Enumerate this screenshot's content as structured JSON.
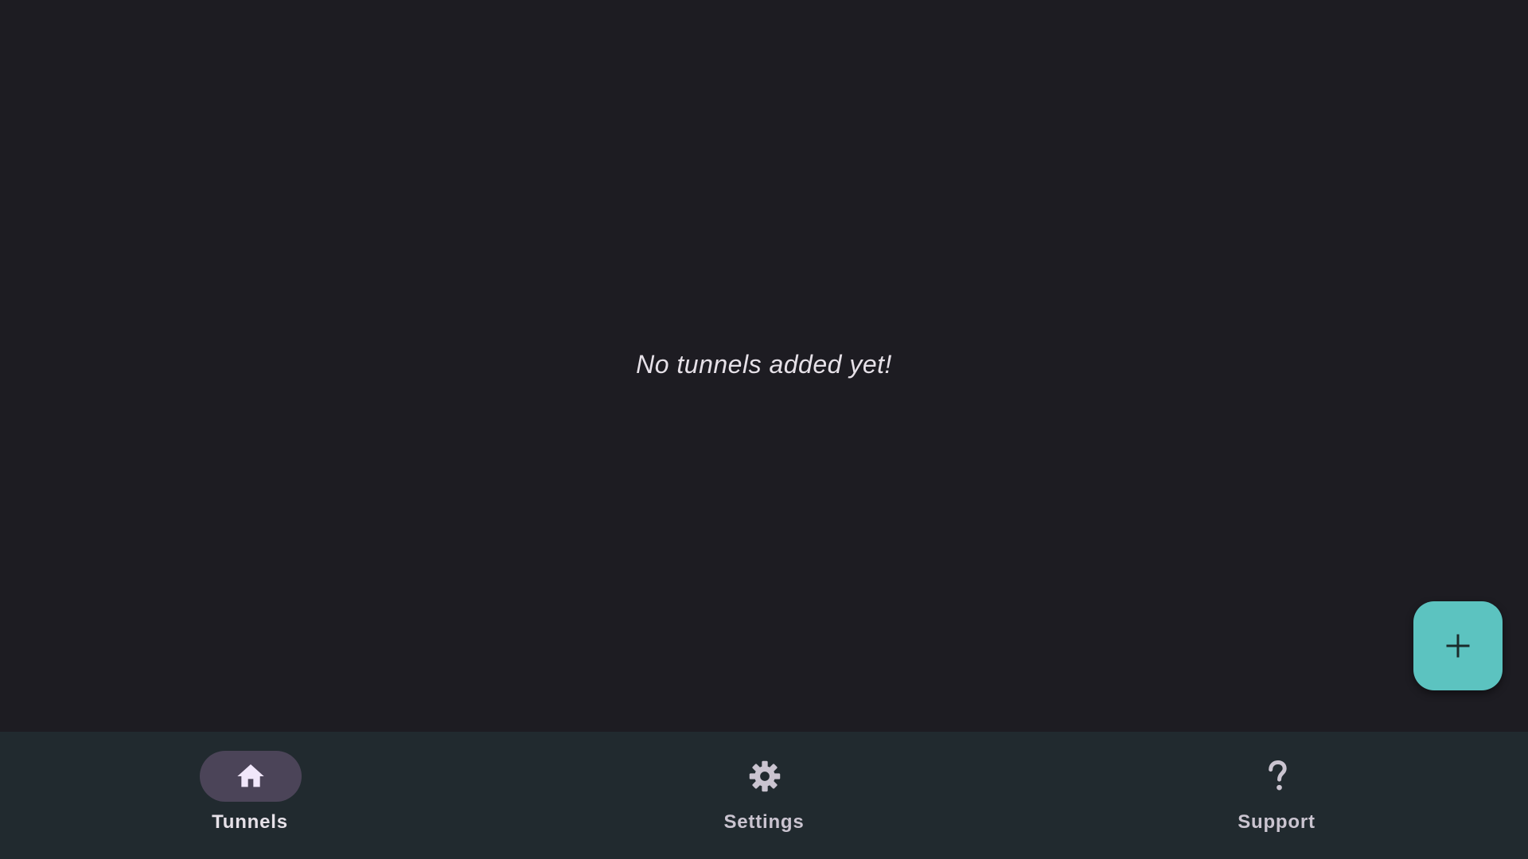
{
  "main": {
    "empty_message": "No tunnels added yet!"
  },
  "fab": {
    "icon": "plus-icon",
    "color": "#5cc3c0"
  },
  "nav": {
    "items": [
      {
        "label": "Tunnels",
        "icon": "home-icon",
        "selected": true
      },
      {
        "label": "Settings",
        "icon": "gear-icon",
        "selected": false
      },
      {
        "label": "Support",
        "icon": "question-mark-icon",
        "selected": false
      }
    ]
  },
  "colors": {
    "background": "#1d1c22",
    "nav_bar": "#212a2f",
    "nav_indicator": "#4b4458",
    "accent": "#5cc3c0"
  }
}
